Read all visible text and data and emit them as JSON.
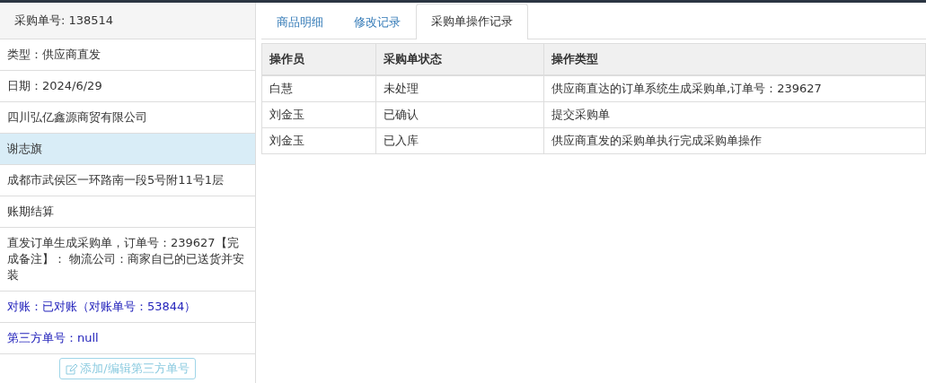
{
  "sidebar": {
    "header": "采购单号: 138514",
    "items": [
      {
        "text": "类型：供应商直发",
        "kind": "plain",
        "selected": false
      },
      {
        "text": "日期：2024/6/29",
        "kind": "plain",
        "selected": false
      },
      {
        "text": "四川弘亿鑫源商贸有限公司",
        "kind": "plain",
        "selected": false
      },
      {
        "text": "谢志旗",
        "kind": "plain",
        "selected": true
      },
      {
        "text": "成都市武侯区一环路南一段5号附11号1层",
        "kind": "plain",
        "selected": false
      },
      {
        "text": "账期结算",
        "kind": "plain",
        "selected": false
      },
      {
        "text": "直发订单生成采购单，订单号：239627【完成备注】： 物流公司：商家自已的已送货并安装",
        "kind": "plain",
        "selected": false
      },
      {
        "text": "对账：已对账（对账单号：53844）",
        "kind": "link",
        "selected": false
      },
      {
        "text": "第三方单号：null",
        "kind": "link",
        "selected": false
      }
    ],
    "button": "添加/编辑第三方单号"
  },
  "tabs": [
    {
      "label": "商品明细",
      "selected": false
    },
    {
      "label": "修改记录",
      "selected": false
    },
    {
      "label": "采购单操作记录",
      "selected": true
    }
  ],
  "table": {
    "columns": [
      "操作员",
      "采购单状态",
      "操作类型"
    ],
    "rows": [
      [
        "白慧",
        "未处理",
        "供应商直达的订单系统生成采购单,订单号：239627"
      ],
      [
        "刘金玉",
        "已确认",
        "提交采购单"
      ],
      [
        "刘金玉",
        "已入库",
        "供应商直发的采购单执行完成采购单操作"
      ]
    ]
  }
}
